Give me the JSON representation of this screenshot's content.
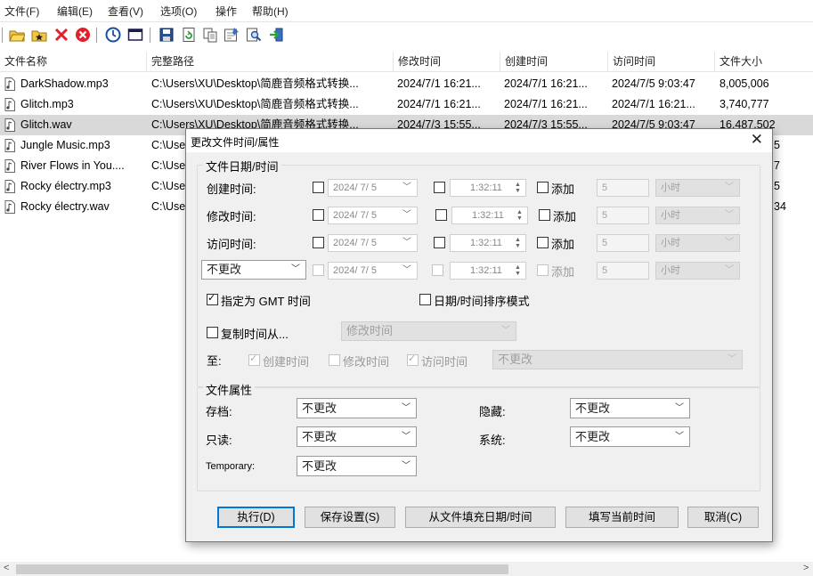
{
  "menu": [
    "文件(F)",
    "编辑(E)",
    "查看(V)",
    "选项(O)",
    "操作",
    "帮助(H)"
  ],
  "columns": [
    "文件名称",
    "完整路径",
    "修改时间",
    "创建时间",
    "访问时间",
    "文件大小"
  ],
  "rows": [
    {
      "name": "DarkShadow.mp3",
      "path": "C:\\Users\\XU\\Desktop\\简鹿音频格式转换...",
      "modified": "2024/7/1 16:21...",
      "created": "2024/7/1 16:21...",
      "accessed": "2024/7/5 9:03:47",
      "size": "8,005,006"
    },
    {
      "name": "Glitch.mp3",
      "path": "C:\\Users\\XU\\Desktop\\简鹿音频格式转换...",
      "modified": "2024/7/1 16:21...",
      "created": "2024/7/1 16:21...",
      "accessed": "2024/7/1 16:21...",
      "size": "3,740,777"
    },
    {
      "name": "Glitch.wav",
      "path": "C:\\Users\\XU\\Desktop\\简鹿音频格式转换...",
      "modified": "2024/7/3 15:55...",
      "created": "2024/7/3 15:55...",
      "accessed": "2024/7/5 9:03:47",
      "size": "16,487,502"
    },
    {
      "name": "Jungle Music.mp3",
      "path": "C:\\Use",
      "modified": "",
      "created": "",
      "accessed": "",
      "size": "5"
    },
    {
      "name": "River Flows in You....",
      "path": "C:\\Use",
      "modified": "",
      "created": "",
      "accessed": "",
      "size": "7"
    },
    {
      "name": "Rocky électry.mp3",
      "path": "C:\\Use",
      "modified": "",
      "created": "",
      "accessed": "",
      "size": "5"
    },
    {
      "name": "Rocky électry.wav",
      "path": "C:\\Use",
      "modified": "",
      "created": "",
      "accessed": "",
      "size": "34"
    }
  ],
  "dialog": {
    "title": "更改文件时间/属性",
    "close": "✕",
    "date_group": "文件日期/时间",
    "rows": [
      {
        "label": "创建时间:",
        "date": "2024/ 7/ 5",
        "time": "1:32:11",
        "add": "添加",
        "amount": "5",
        "unit": "小时"
      },
      {
        "label": "修改时间:",
        "date": "2024/ 7/ 5",
        "time": "1:32:11",
        "add": "添加",
        "amount": "5",
        "unit": "小时"
      },
      {
        "label": "访问时间:",
        "date": "2024/ 7/ 5",
        "time": "1:32:11",
        "add": "添加",
        "amount": "5",
        "unit": "小时"
      },
      {
        "label": "不更改",
        "date": "2024/ 7/ 5",
        "time": "1:32:11",
        "add": "添加",
        "amount": "5",
        "unit": "小时"
      }
    ],
    "gmt": "指定为 GMT 时间",
    "sort_mode": "日期/时间排序模式",
    "copy_from": "复制时间从...",
    "copy_source": "修改时间",
    "to_label": "至:",
    "to_created": "创建时间",
    "to_modified": "修改时间",
    "to_accessed": "访问时间",
    "to_select": "不更改",
    "attr_group": "文件属性",
    "attr": {
      "archive_label": "存档:",
      "archive": "不更改",
      "hidden_label": "隐藏:",
      "hidden": "不更改",
      "readonly_label": "只读:",
      "readonly": "不更改",
      "system_label": "系统:",
      "system": "不更改",
      "temporary_label": "Temporary:",
      "temporary": "不更改"
    },
    "buttons": {
      "execute": "执行(D)",
      "save": "保存设置(S)",
      "fill_from_file": "从文件填充日期/时间",
      "fill_now": "填写当前时间",
      "cancel": "取消(C)"
    }
  },
  "scroll": {
    "left": "<",
    "right": ">"
  }
}
